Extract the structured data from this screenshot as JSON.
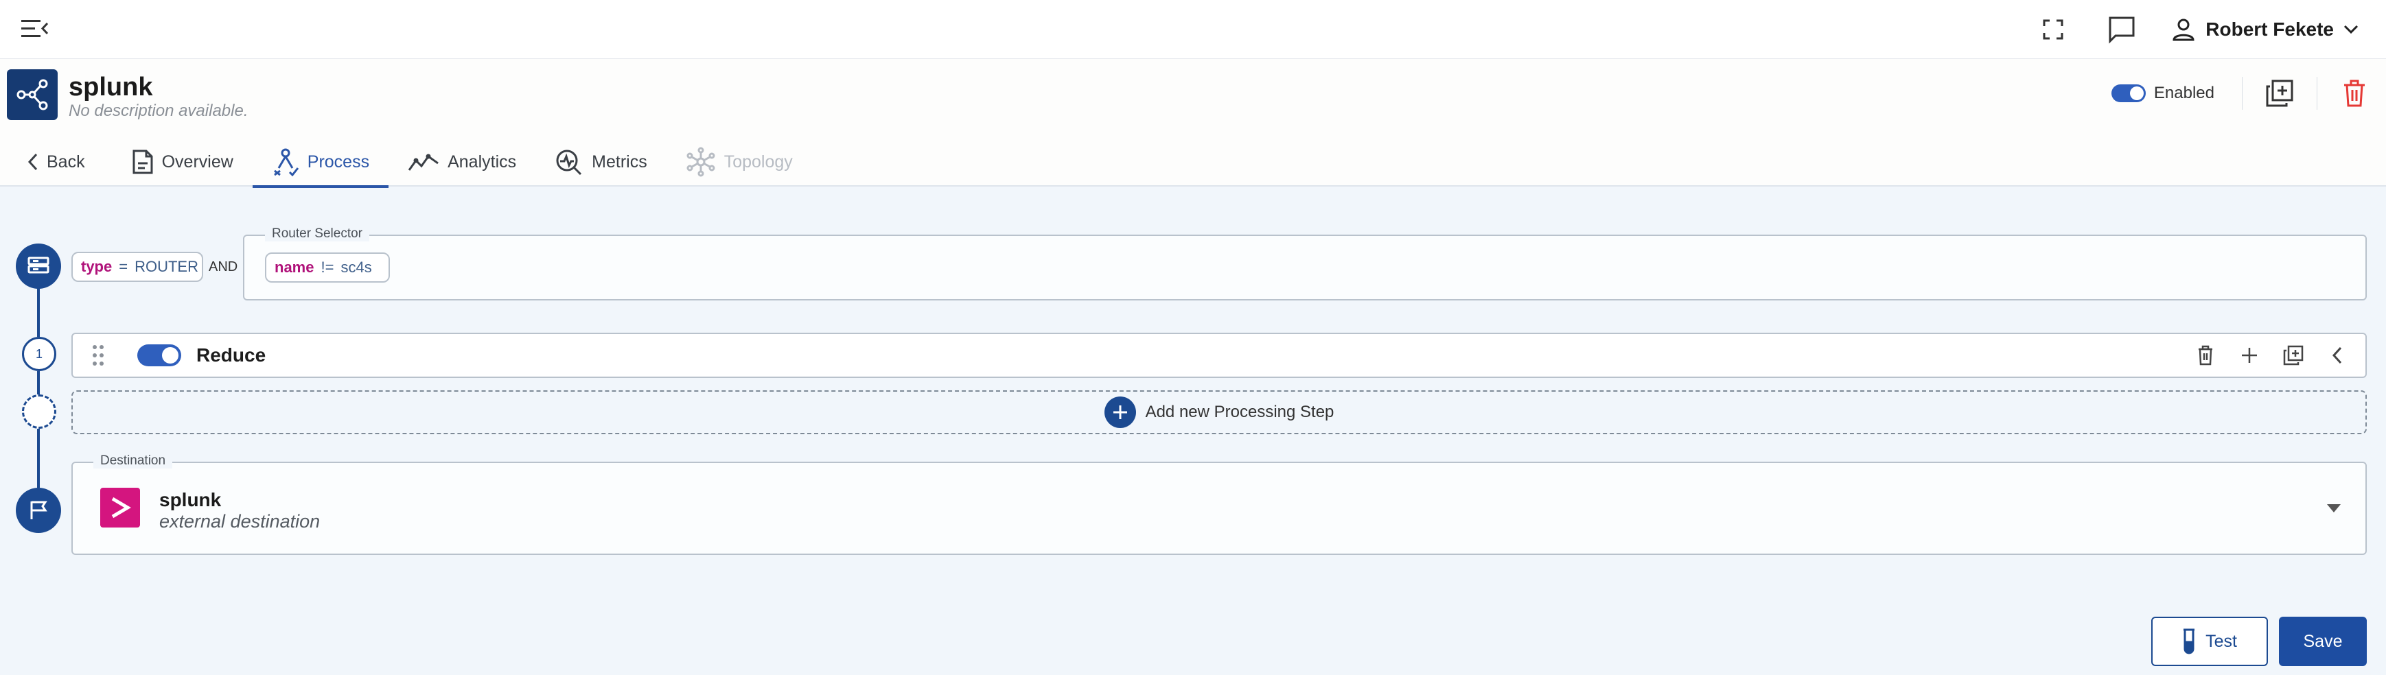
{
  "topbar": {
    "user_name": "Robert Fekete",
    "icons": [
      "menu-collapse-icon",
      "fullscreen-icon",
      "chat-icon",
      "user-icon",
      "chevron-down-icon"
    ]
  },
  "pipeline": {
    "name": "splunk",
    "description": "No description available.",
    "enabled_label": "Enabled",
    "enabled": true
  },
  "tabs": [
    {
      "label": "Back",
      "icon": "chevron-left-icon",
      "state": "normal"
    },
    {
      "label": "Overview",
      "icon": "document-icon",
      "state": "normal"
    },
    {
      "label": "Process",
      "icon": "process-icon",
      "state": "active"
    },
    {
      "label": "Analytics",
      "icon": "analytics-icon",
      "state": "normal"
    },
    {
      "label": "Metrics",
      "icon": "metrics-icon",
      "state": "normal"
    },
    {
      "label": "Topology",
      "icon": "topology-icon",
      "state": "disabled"
    }
  ],
  "process": {
    "source_filter": {
      "chip_key": "type",
      "chip_op": "=",
      "chip_value": "ROUTER",
      "and_label": "AND"
    },
    "router_selector": {
      "legend": "Router Selector",
      "chip_key": "name",
      "chip_op": "!=",
      "chip_value": "sc4s"
    },
    "steps": [
      {
        "number": "1",
        "name": "Reduce",
        "enabled": true
      }
    ],
    "add_step_label": "Add new Processing Step",
    "destination": {
      "legend": "Destination",
      "name": "splunk",
      "subtitle": "external destination"
    }
  },
  "actions": {
    "test_label": "Test",
    "save_label": "Save"
  },
  "colors": {
    "primary": "#1c4a91",
    "accent_toggle": "#2f5fbd",
    "chip_key": "#b0127a",
    "delete": "#e53935",
    "splunk_brand": "#d4157f",
    "background": "#f1f6fb"
  }
}
